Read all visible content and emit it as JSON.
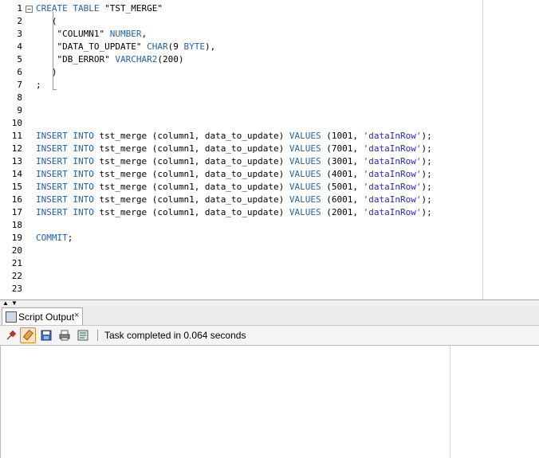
{
  "editor": {
    "lines": [
      {
        "n": "1",
        "parts": [
          {
            "t": "CREATE TABLE ",
            "c": "kw"
          },
          {
            "t": "\"TST_MERGE\"",
            "c": ""
          }
        ]
      },
      {
        "n": "2",
        "parts": [
          {
            "t": "   (",
            "c": ""
          }
        ]
      },
      {
        "n": "3",
        "parts": [
          {
            "t": "    \"COLUMN1\" ",
            "c": ""
          },
          {
            "t": "NUMBER",
            "c": "kw"
          },
          {
            "t": ",",
            "c": ""
          }
        ]
      },
      {
        "n": "4",
        "parts": [
          {
            "t": "    \"DATA_TO_UPDATE\" ",
            "c": ""
          },
          {
            "t": "CHAR",
            "c": "kw"
          },
          {
            "t": "(9 ",
            "c": ""
          },
          {
            "t": "BYTE",
            "c": "kw"
          },
          {
            "t": "),",
            "c": ""
          }
        ]
      },
      {
        "n": "5",
        "parts": [
          {
            "t": "    \"DB_ERROR\" ",
            "c": ""
          },
          {
            "t": "VARCHAR2",
            "c": "kw"
          },
          {
            "t": "(200)",
            "c": ""
          }
        ]
      },
      {
        "n": "6",
        "parts": [
          {
            "t": "   )",
            "c": ""
          }
        ]
      },
      {
        "n": "7",
        "parts": [
          {
            "t": ";",
            "c": ""
          }
        ]
      },
      {
        "n": "8",
        "parts": []
      },
      {
        "n": "9",
        "parts": []
      },
      {
        "n": "10",
        "parts": []
      },
      {
        "n": "11",
        "parts": [
          {
            "t": "INSERT INTO ",
            "c": "kw"
          },
          {
            "t": "tst_merge (column1, data_to_update) ",
            "c": ""
          },
          {
            "t": "VALUES",
            "c": "kw"
          },
          {
            "t": " (1001, ",
            "c": ""
          },
          {
            "t": "'dataInRow'",
            "c": "str"
          },
          {
            "t": ");",
            "c": ""
          }
        ]
      },
      {
        "n": "12",
        "parts": [
          {
            "t": "INSERT INTO ",
            "c": "kw"
          },
          {
            "t": "tst_merge (column1, data_to_update) ",
            "c": ""
          },
          {
            "t": "VALUES",
            "c": "kw"
          },
          {
            "t": " (7001, ",
            "c": ""
          },
          {
            "t": "'dataInRow'",
            "c": "str"
          },
          {
            "t": ");",
            "c": ""
          }
        ]
      },
      {
        "n": "13",
        "parts": [
          {
            "t": "INSERT INTO ",
            "c": "kw"
          },
          {
            "t": "tst_merge (column1, data_to_update) ",
            "c": ""
          },
          {
            "t": "VALUES",
            "c": "kw"
          },
          {
            "t": " (3001, ",
            "c": ""
          },
          {
            "t": "'dataInRow'",
            "c": "str"
          },
          {
            "t": ");",
            "c": ""
          }
        ]
      },
      {
        "n": "14",
        "parts": [
          {
            "t": "INSERT INTO ",
            "c": "kw"
          },
          {
            "t": "tst_merge (column1, data_to_update) ",
            "c": ""
          },
          {
            "t": "VALUES",
            "c": "kw"
          },
          {
            "t": " (4001, ",
            "c": ""
          },
          {
            "t": "'dataInRow'",
            "c": "str"
          },
          {
            "t": ");",
            "c": ""
          }
        ]
      },
      {
        "n": "15",
        "parts": [
          {
            "t": "INSERT INTO ",
            "c": "kw"
          },
          {
            "t": "tst_merge (column1, data_to_update) ",
            "c": ""
          },
          {
            "t": "VALUES",
            "c": "kw"
          },
          {
            "t": " (5001, ",
            "c": ""
          },
          {
            "t": "'dataInRow'",
            "c": "str"
          },
          {
            "t": ");",
            "c": ""
          }
        ]
      },
      {
        "n": "16",
        "parts": [
          {
            "t": "INSERT INTO ",
            "c": "kw"
          },
          {
            "t": "tst_merge (column1, data_to_update) ",
            "c": ""
          },
          {
            "t": "VALUES",
            "c": "kw"
          },
          {
            "t": " (6001, ",
            "c": ""
          },
          {
            "t": "'dataInRow'",
            "c": "str"
          },
          {
            "t": ");",
            "c": ""
          }
        ]
      },
      {
        "n": "17",
        "parts": [
          {
            "t": "INSERT INTO ",
            "c": "kw"
          },
          {
            "t": "tst_merge (column1, data_to_update) ",
            "c": ""
          },
          {
            "t": "VALUES",
            "c": "kw"
          },
          {
            "t": " (2001, ",
            "c": ""
          },
          {
            "t": "'dataInRow'",
            "c": "str"
          },
          {
            "t": ");",
            "c": ""
          }
        ]
      },
      {
        "n": "18",
        "parts": []
      },
      {
        "n": "19",
        "parts": [
          {
            "t": "COMMIT",
            "c": "kw"
          },
          {
            "t": ";",
            "c": ""
          }
        ]
      },
      {
        "n": "20",
        "parts": []
      },
      {
        "n": "21",
        "parts": []
      },
      {
        "n": "22",
        "parts": []
      },
      {
        "n": "23",
        "parts": []
      }
    ],
    "fold_icon": "minus-icon"
  },
  "splitter": {
    "up_glyph": "▲",
    "down_glyph": "▼"
  },
  "output_panel": {
    "tab_label": "Script Output",
    "tab_close": "×",
    "status": "Task completed in 0.064 seconds",
    "toolbar_icons": [
      "pin-icon",
      "eraser-icon",
      "save-icon",
      "print-icon",
      "output-log-icon"
    ]
  },
  "colors": {
    "keyword": "#1f5fb8",
    "string": "#2a2ac8",
    "active_button": "#fbe2c2"
  }
}
